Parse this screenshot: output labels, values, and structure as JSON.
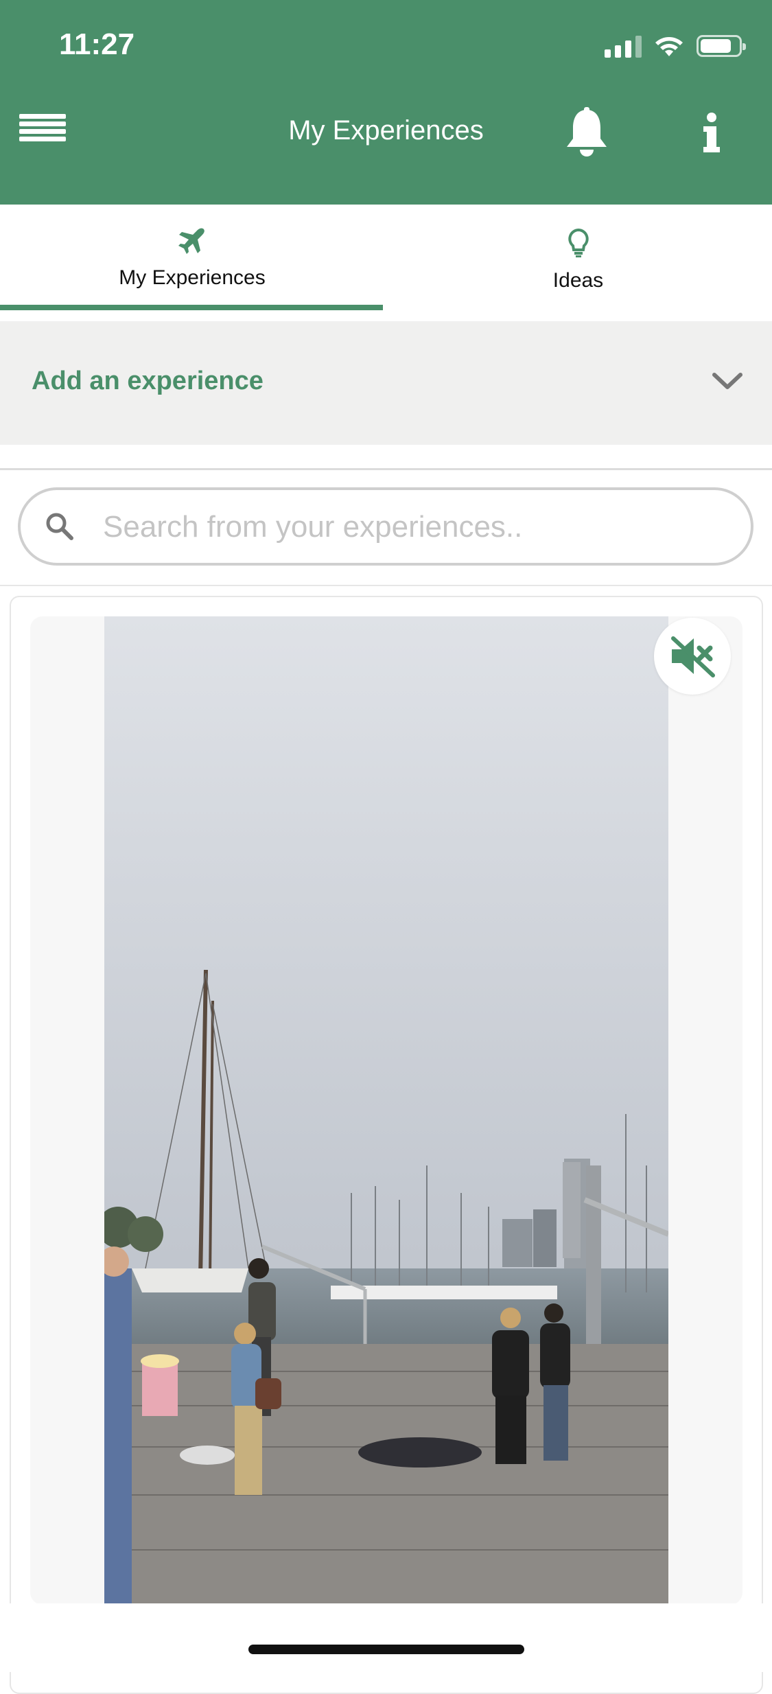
{
  "status_bar": {
    "time": "11:27"
  },
  "header": {
    "title": "My Experiences"
  },
  "tabs": [
    {
      "label": "My Experiences",
      "icon": "airplane-icon",
      "active": true
    },
    {
      "label": "Ideas",
      "icon": "lightbulb-icon",
      "active": false
    }
  ],
  "add_experience": {
    "label": "Add an experience"
  },
  "search": {
    "placeholder": "Search from your experiences..",
    "value": ""
  },
  "colors": {
    "brand": "#4a8f6a",
    "accent_bg": "#f0f0ef"
  },
  "media": {
    "muted": true,
    "icon": "speaker-muted-icon"
  }
}
